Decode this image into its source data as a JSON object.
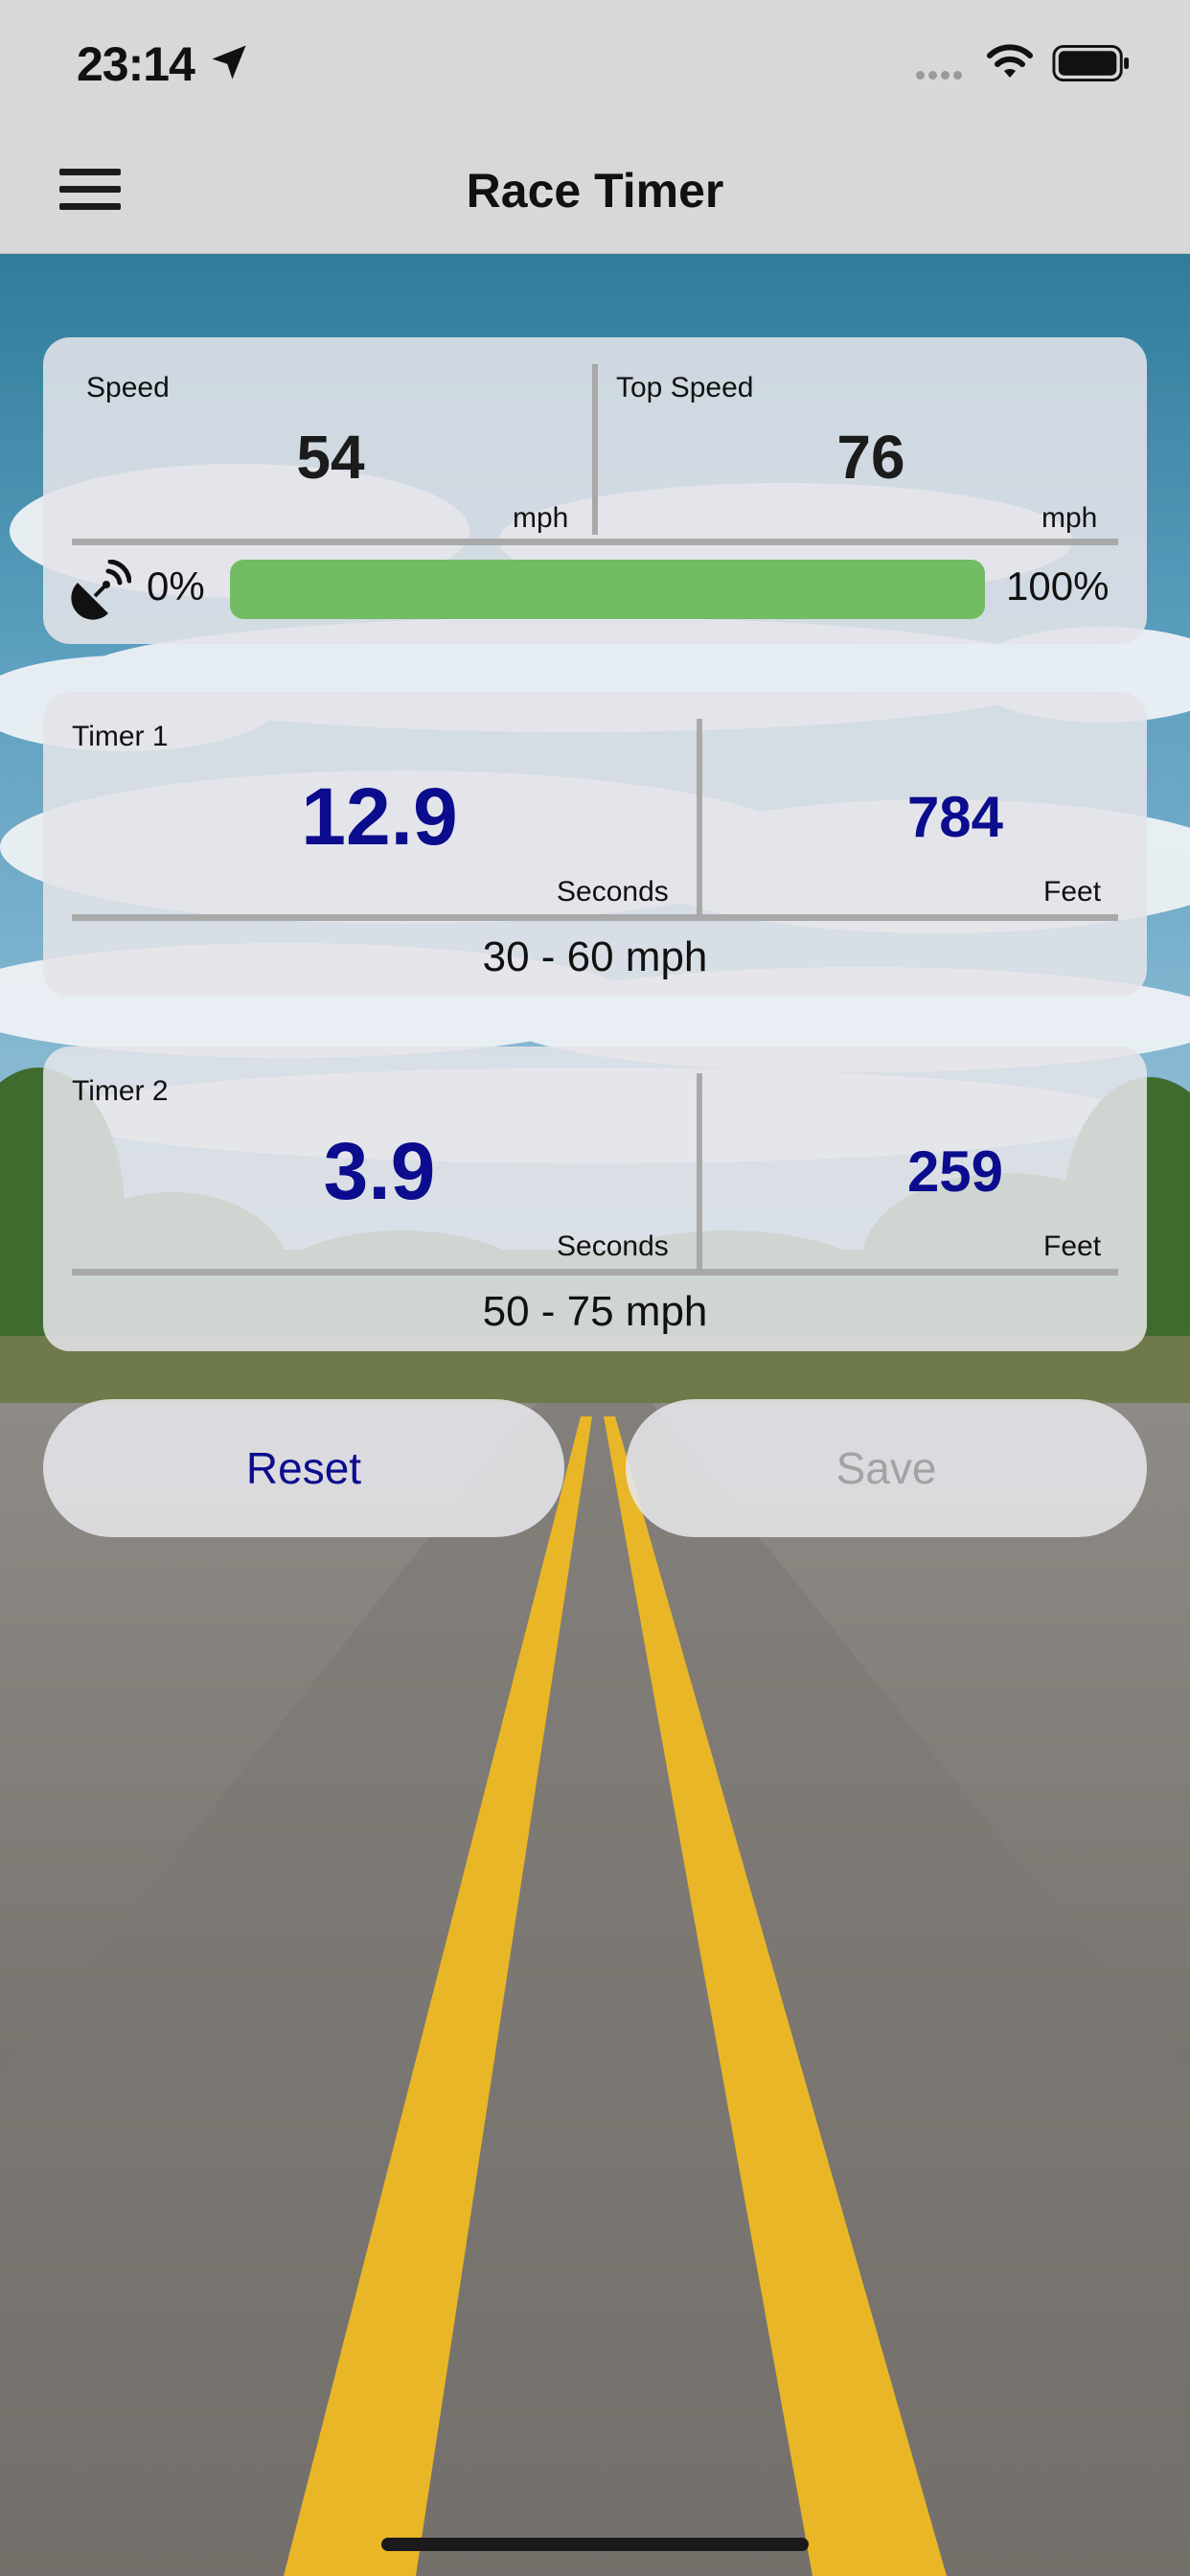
{
  "status_bar": {
    "time": "23:14"
  },
  "nav": {
    "title": "Race Timer"
  },
  "speed_card": {
    "speed_label": "Speed",
    "speed_value": "54",
    "speed_unit": "mph",
    "top_speed_label": "Top Speed",
    "top_speed_value": "76",
    "top_speed_unit": "mph",
    "gps_min_label": "0%",
    "gps_max_label": "100%",
    "gps_signal_fraction": 1.0
  },
  "timer1": {
    "label": "Timer 1",
    "seconds_value": "12.9",
    "seconds_unit": "Seconds",
    "feet_value": "784",
    "feet_unit": "Feet",
    "range": "30 - 60 mph"
  },
  "timer2": {
    "label": "Timer 2",
    "seconds_value": "3.9",
    "seconds_unit": "Seconds",
    "feet_value": "259",
    "feet_unit": "Feet",
    "range": "50 - 75 mph"
  },
  "buttons": {
    "reset_label": "Reset",
    "save_label": "Save"
  },
  "colors": {
    "accent_blue": "#0c0c8e",
    "gps_green": "#72bc63",
    "bar_gray": "#d8d8d8",
    "disabled_text": "#a3a3a3"
  },
  "icons": {
    "menu": "hamburger-menu-icon",
    "location": "location-arrow-icon",
    "wifi": "wifi-icon",
    "battery": "battery-icon",
    "gps": "satellite-dish-icon"
  }
}
